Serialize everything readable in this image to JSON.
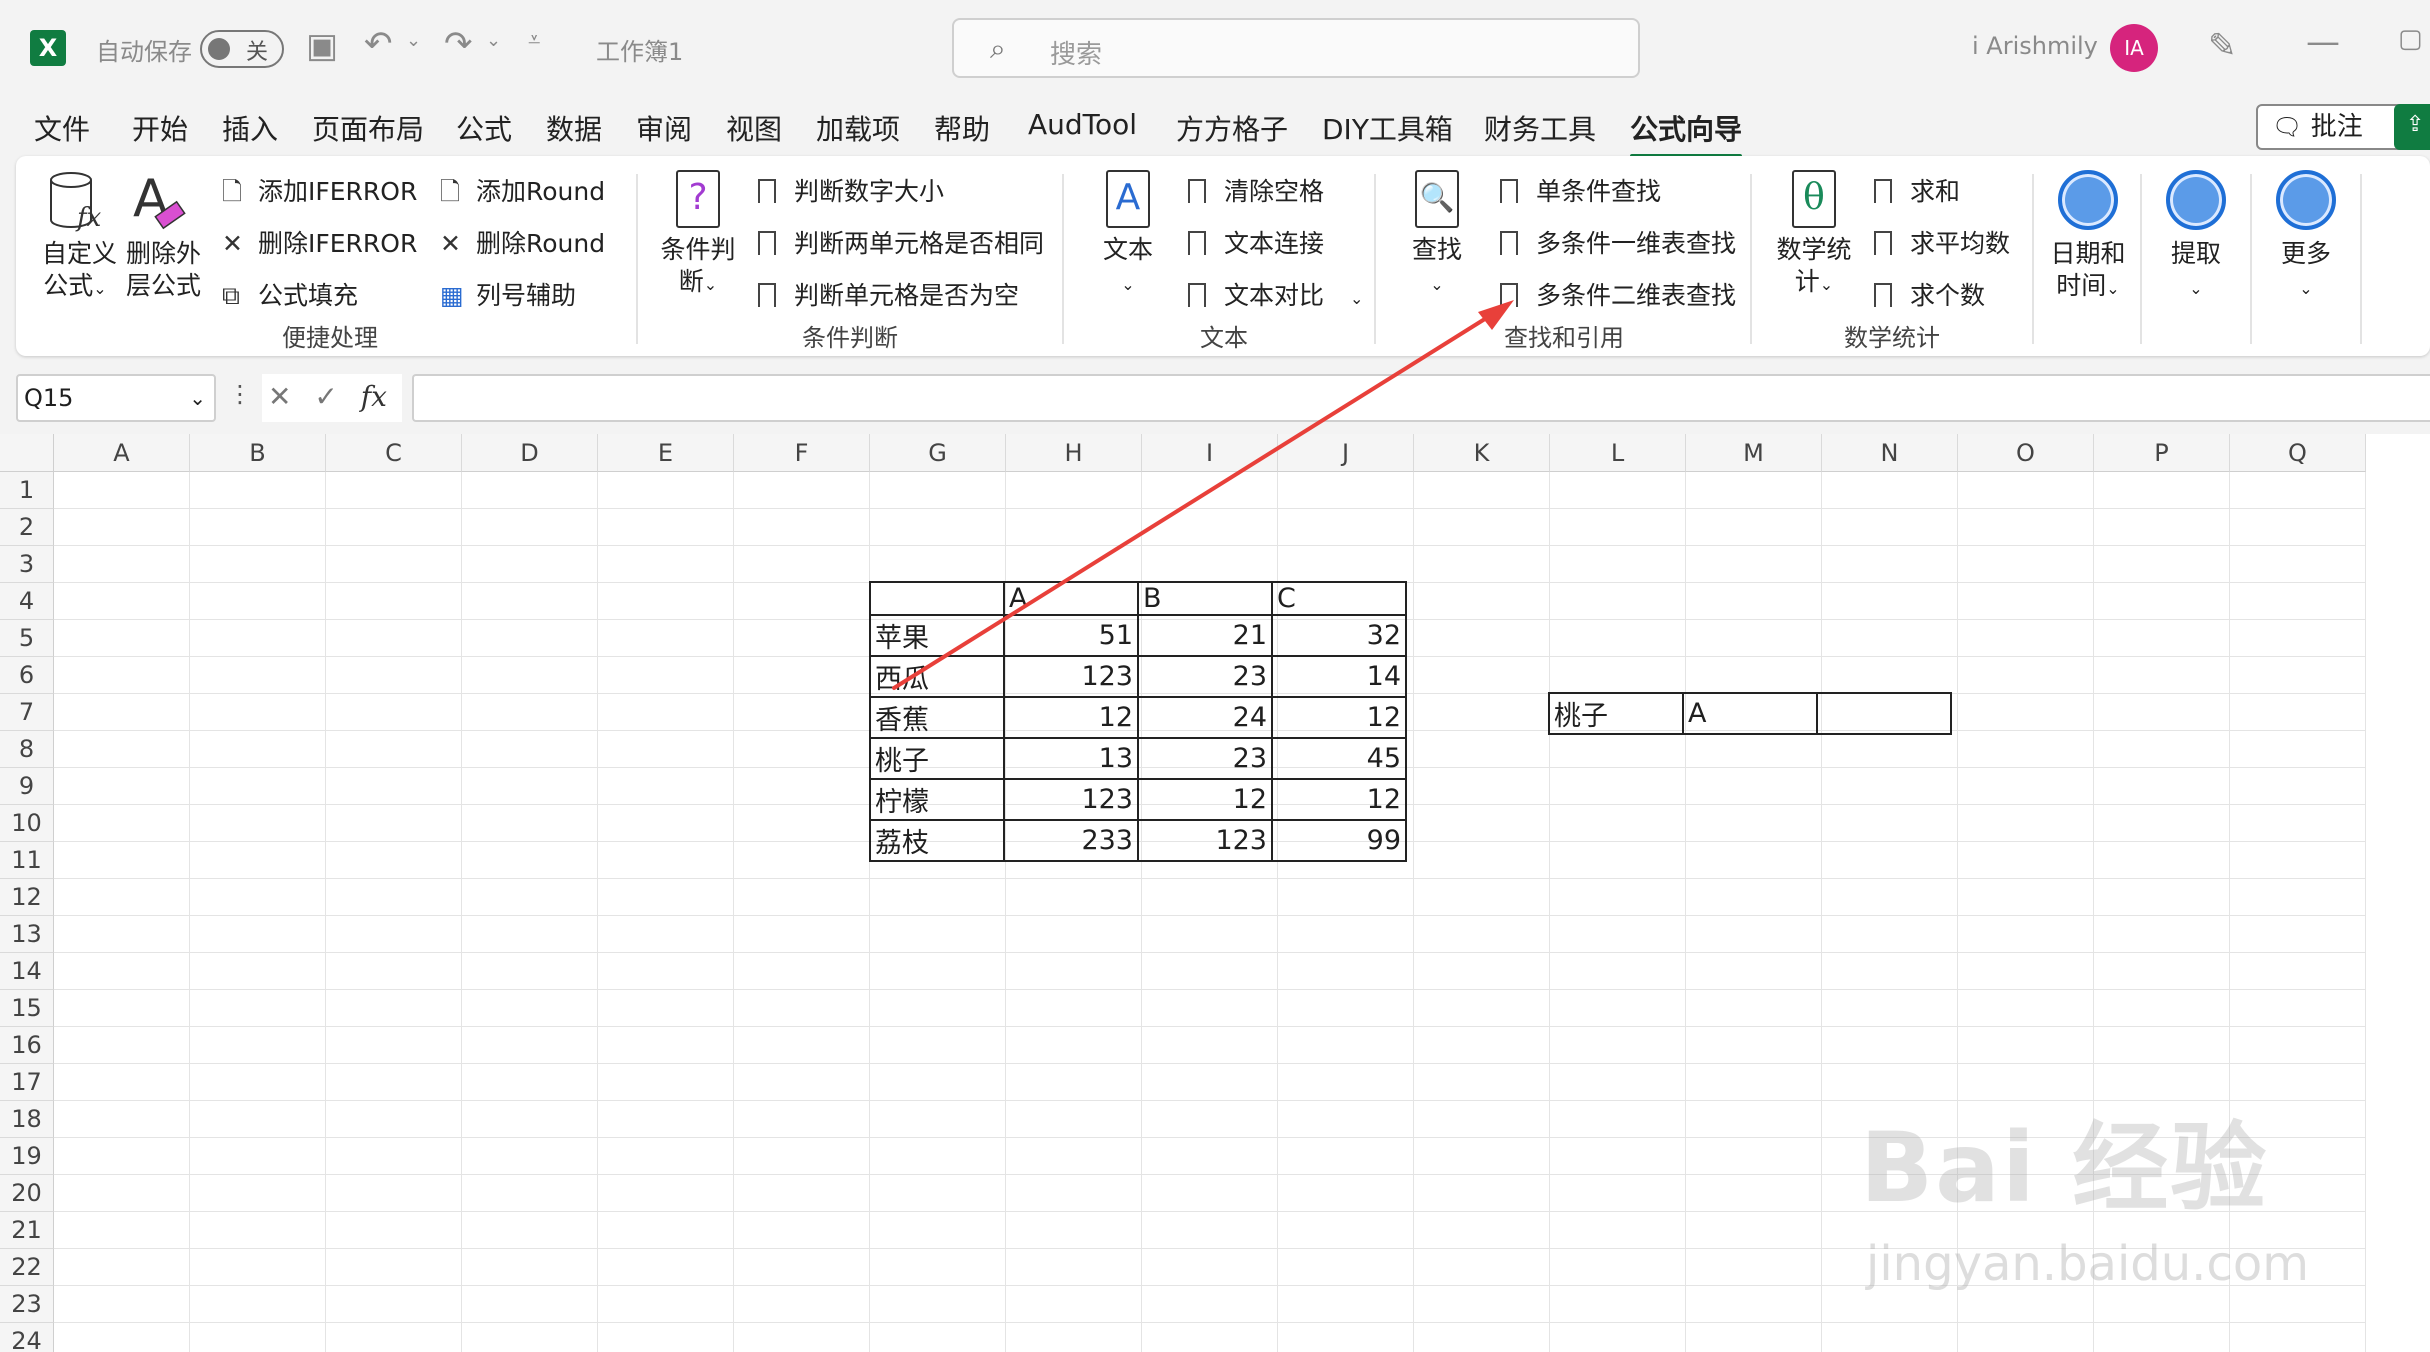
{
  "titlebar": {
    "autosave_label": "自动保存",
    "autosave_state": "关",
    "workbook": "工作簿1",
    "search_placeholder": "搜索",
    "user": "i Arishmily",
    "avatar": "IA"
  },
  "tabs": [
    "文件",
    "开始",
    "插入",
    "页面布局",
    "公式",
    "数据",
    "审阅",
    "视图",
    "加载项",
    "帮助",
    "AudTool",
    "方方格子",
    "DIY工具箱",
    "财务工具",
    "公式向导"
  ],
  "active_tab": "公式向导",
  "comment_button": "批注",
  "ribbon": {
    "g1": {
      "label": "便捷处理",
      "big1": "自定义\n公式",
      "big2": "删除外\n层公式",
      "items": [
        "添加IFERROR",
        "删除IFERROR",
        "公式填充",
        "添加Round",
        "删除Round",
        "列号辅助"
      ]
    },
    "g2": {
      "label": "条件判断",
      "big": "条件判\n断",
      "items": [
        "判断数字大小",
        "判断两单元格是否相同",
        "判断单元格是否为空"
      ]
    },
    "g3": {
      "label": "文本",
      "big": "文本",
      "items": [
        "清除空格",
        "文本连接",
        "文本对比"
      ]
    },
    "g4": {
      "label": "查找和引用",
      "big": "查找",
      "items": [
        "单条件查找",
        "多条件一维表查找",
        "多条件二维表查找"
      ]
    },
    "g5": {
      "label": "数学统计",
      "big": "数学统\n计",
      "items": [
        "求和",
        "求平均数",
        "求个数"
      ]
    },
    "g6": {
      "big": "日期和\n时间"
    },
    "g7": {
      "big": "提取"
    },
    "g8": {
      "big": "更多"
    }
  },
  "namebox": "Q15",
  "columns": [
    "A",
    "B",
    "C",
    "D",
    "E",
    "F",
    "G",
    "H",
    "I",
    "J",
    "K",
    "L",
    "M",
    "N",
    "O",
    "P",
    "Q"
  ],
  "rows": [
    "1",
    "2",
    "3",
    "4",
    "5",
    "6",
    "7",
    "8",
    "9",
    "10",
    "11",
    "12",
    "13",
    "14",
    "15",
    "16",
    "17",
    "18",
    "19",
    "20",
    "21",
    "22",
    "23",
    "24"
  ],
  "table": {
    "header": [
      "",
      "A",
      "B",
      "C"
    ],
    "rows": [
      [
        "苹果",
        "51",
        "21",
        "32"
      ],
      [
        "西瓜",
        "123",
        "23",
        "14"
      ],
      [
        "香蕉",
        "12",
        "24",
        "12"
      ],
      [
        "桃子",
        "13",
        "23",
        "45"
      ],
      [
        "柠檬",
        "123",
        "12",
        "12"
      ],
      [
        "荔枝",
        "233",
        "123",
        "99"
      ]
    ]
  },
  "lookup": [
    "桃子",
    "A",
    ""
  ],
  "annotation_color": "#e8403a",
  "accent": "#107c41",
  "watermark": {
    "main": "Bai 经验",
    "sub": "jingyan.baidu.com"
  }
}
